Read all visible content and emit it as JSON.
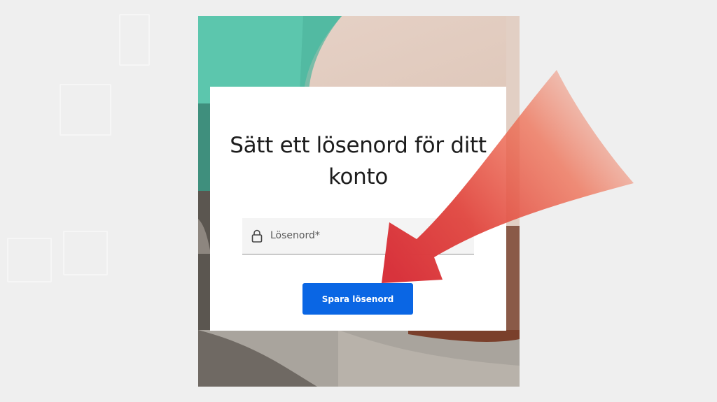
{
  "heading": "Sätt ett lösenord för ditt konto",
  "password_field": {
    "placeholder": "Lösenord*",
    "icon": "lock-icon"
  },
  "save_button": {
    "label": "Spara lösenord"
  },
  "colors": {
    "button": "#0a66e4",
    "arrow": "#e2463d",
    "background": "#efefef",
    "card": "#ffffff"
  }
}
